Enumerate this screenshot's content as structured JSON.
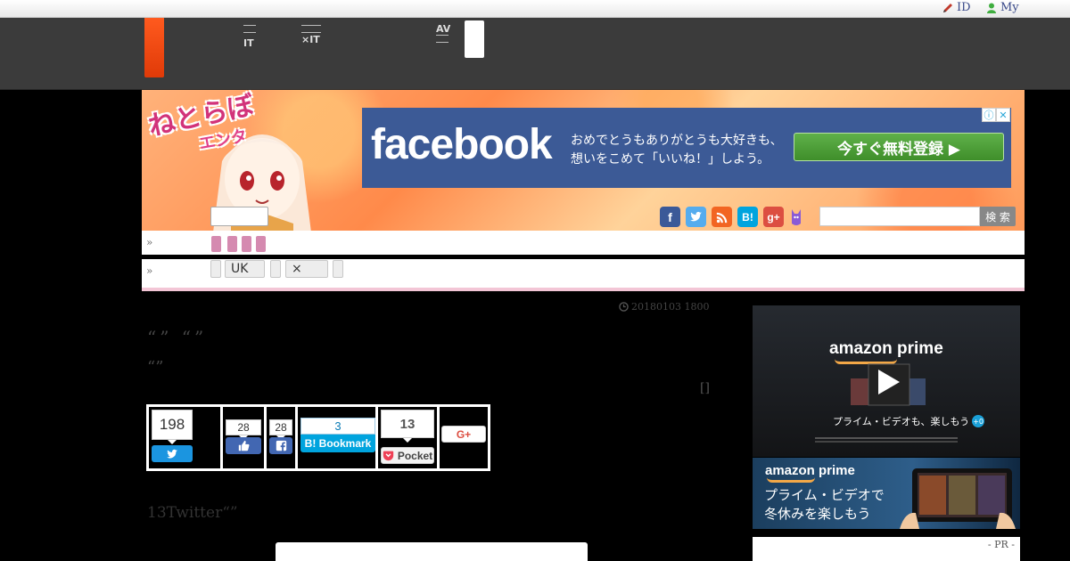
{
  "topbar": {
    "id_link": "ID",
    "my_link": "My"
  },
  "nav": {
    "items": [
      {
        "line1": "",
        "line2": "IT"
      },
      {
        "line1": "",
        "line2": "×IT"
      },
      {
        "line1": "AV",
        "line2": ""
      }
    ]
  },
  "banner": {
    "logo_line1": "ねとらぼ",
    "logo_line2": "エンタ",
    "ad": {
      "brand": "facebook",
      "copy_line1": "おめでとうもありがとうも大好きも、",
      "copy_line2": "想いをこめて「いいね！」しよう。",
      "cta": "今すぐ無料登録 ▶",
      "info_icon": "ⓘ",
      "close_icon": "✕"
    },
    "social": [
      "f",
      "t",
      "rss",
      "B!",
      "g+",
      "n"
    ],
    "search_button": "検 索"
  },
  "ticker1": {
    "arrow": "»"
  },
  "ticker2": {
    "arrow": "»",
    "chips": [
      "",
      "UK",
      "",
      "×",
      ""
    ]
  },
  "article": {
    "date": "20180103 1800",
    "title": "“”  “”",
    "subtitle": "“”",
    "bracket": "[]",
    "body": "13Twitter“”"
  },
  "share": {
    "twitter_count": "198",
    "like_count": "28",
    "fb_count": "28",
    "hatena_count": "3",
    "hatena_label": "B! Bookmark",
    "pocket_count": "13",
    "pocket_label": "Pocket",
    "gplus_label": "G+"
  },
  "sidebar": {
    "amazon1": {
      "logo": "amazon prime",
      "caption": "プライム・ビデオも、楽しもう",
      "badge": "+0"
    },
    "amazon2": {
      "logo": "amazon prime",
      "line1": "プライム・ビデオで",
      "line2": "冬休みを楽しもう"
    },
    "pr_label": "- PR -"
  },
  "colors": {
    "nav_bg": "#3b3b3b",
    "accent": "#ff5a1e",
    "facebook": "#3c5a96",
    "twitter": "#1b95e0",
    "hatena": "#00a4de",
    "pocket": "#ef4056",
    "gplus": "#dc4e41"
  }
}
